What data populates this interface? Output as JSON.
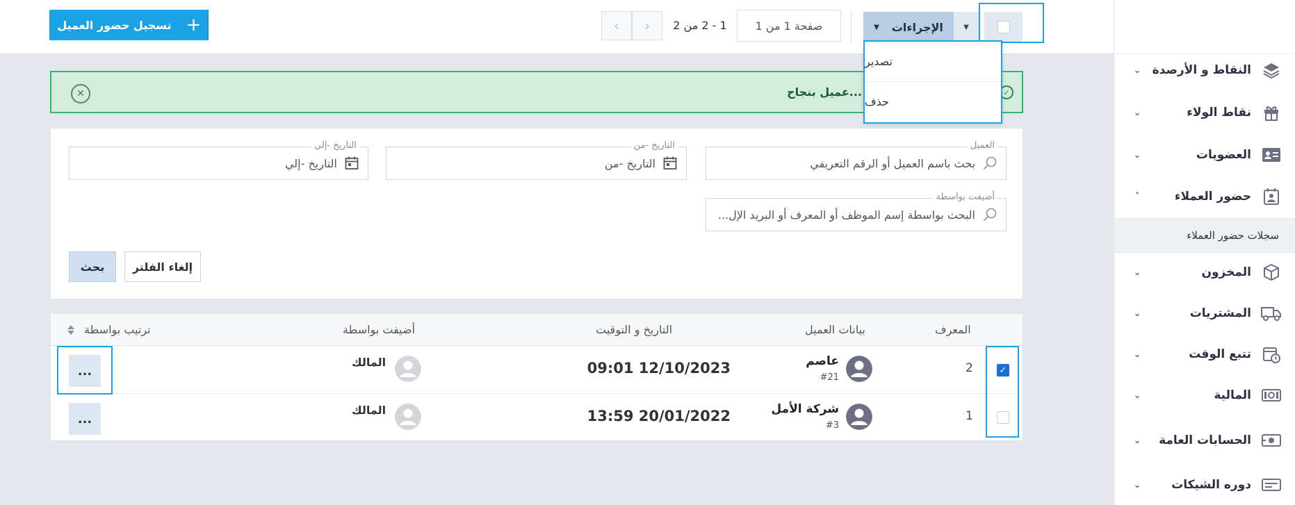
{
  "topbar": {
    "add_button_label": "تسجيل حضور العميل",
    "pagination_range": "1 - 2 من 2",
    "pagination_page": "صفحة 1 من 1",
    "actions_label": "الإجراءات",
    "actions_menu": [
      "تصدير",
      "حذف"
    ]
  },
  "alert": {
    "message": "...عميل بنجاح"
  },
  "filters": {
    "customer_label": "العميل",
    "customer_placeholder": "بحث باسم العميل أو الرقم التعريفي",
    "date_from_label": "التاريخ -من",
    "date_from_placeholder": "التاريخ -من",
    "date_to_label": "التاريخ -إلي",
    "date_to_placeholder": "التاريخ -إلي",
    "added_by_label": "أضيفت بواسطة",
    "added_by_placeholder": "البحث بواسطة إسم الموظف أو المعرف أو البريد الإل...",
    "search_button": "بحث",
    "clear_button": "إلغاء الفلتر"
  },
  "table": {
    "headers": {
      "id": "المعرف",
      "customer": "بيانات العميل",
      "datetime": "التاريخ و التوقيت",
      "added_by": "أضيفت بواسطة",
      "sort": "ترتيب بواسطة"
    },
    "rows": [
      {
        "id": "2",
        "name": "عاصم",
        "number": "#21",
        "datetime": "09:01 12/10/2023",
        "added_by": "المالك",
        "checked": true
      },
      {
        "id": "1",
        "name": "شركة الأمل",
        "number": "#3",
        "datetime": "13:59 20/01/2022",
        "added_by": "المالك",
        "checked": false
      }
    ],
    "more_label": "..."
  },
  "sidebar": {
    "items": [
      {
        "label": "النقاط و الأرصدة",
        "icon": "layers-icon"
      },
      {
        "label": "نقاط الولاء",
        "icon": "gift-icon"
      },
      {
        "label": "العضويات",
        "icon": "id-card-icon"
      },
      {
        "label": "حضور العملاء",
        "icon": "attendance-icon"
      },
      {
        "label": "المخزون",
        "icon": "box-icon"
      },
      {
        "label": "المشتريات",
        "icon": "truck-icon"
      },
      {
        "label": "تتبع الوقت",
        "icon": "calendar-clock-icon"
      },
      {
        "label": "المالية",
        "icon": "cash-icon"
      },
      {
        "label": "الحسابات العامة",
        "icon": "accounts-icon"
      },
      {
        "label": "دوره الشيكات",
        "icon": "cheque-icon"
      }
    ],
    "sub_item": "سجلات حضور العملاء"
  },
  "colors": {
    "primary": "#1ba1e6",
    "success_bg": "#d2ecdd",
    "success_border": "#38b56a",
    "checkbox_checked": "#1b6fd6"
  }
}
